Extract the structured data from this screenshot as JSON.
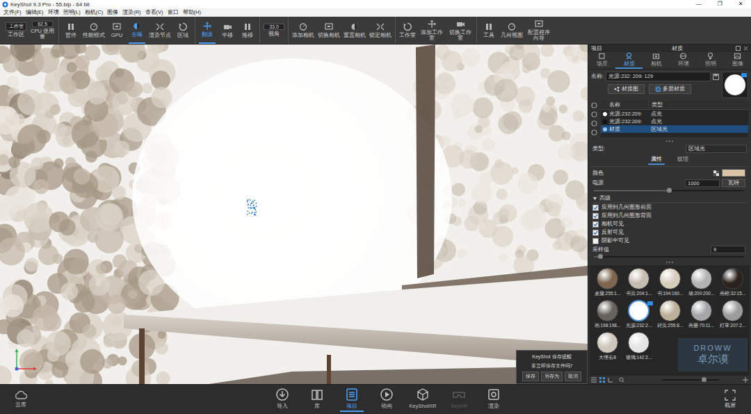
{
  "window": {
    "title": "KeyShot 9.3 Pro  - 55.bip  - 64 bit",
    "controls": [
      "—",
      "❐",
      "✕"
    ]
  },
  "menu": [
    "文件(F)",
    "编辑(E)",
    "环境",
    "照明(L)",
    "相机(C)",
    "图像",
    "渲染(R)",
    "查看(V)",
    "窗口",
    "帮助(H)"
  ],
  "toolbar": [
    [
      {
        "label": "工作区",
        "kind": "field",
        "value": "工作室",
        "active": false
      },
      {
        "label": "CPU 使用量",
        "kind": "field",
        "value": "62.5",
        "active": false
      }
    ],
    [
      {
        "label": "暂停",
        "kind": "button",
        "active": false
      },
      {
        "label": "性能模式",
        "kind": "button",
        "active": false
      },
      {
        "label": "GPU",
        "kind": "button",
        "active": false
      },
      {
        "label": "去噪",
        "kind": "button",
        "active": true
      },
      {
        "label": "渲染节点",
        "kind": "button",
        "active": false
      },
      {
        "label": "区域",
        "kind": "button",
        "active": false
      }
    ],
    [
      {
        "label": "翻滚",
        "kind": "button",
        "active": true
      },
      {
        "label": "平移",
        "kind": "button",
        "active": false
      },
      {
        "label": "推移",
        "kind": "button",
        "active": false
      }
    ],
    [
      {
        "label": "视角",
        "kind": "field",
        "value": "33.0",
        "active": false
      }
    ],
    [
      {
        "label": "添加相机",
        "kind": "button",
        "active": false
      },
      {
        "label": "切换相机",
        "kind": "button",
        "active": false
      },
      {
        "label": "重置相机",
        "kind": "button",
        "active": false
      },
      {
        "label": "锁定相机",
        "kind": "button",
        "active": false
      }
    ],
    [
      {
        "label": "工作室",
        "kind": "button",
        "active": false
      },
      {
        "label": "添加工作室",
        "kind": "button",
        "active": false
      },
      {
        "label": "切换工作室",
        "kind": "button",
        "active": false
      }
    ],
    [
      {
        "label": "工具",
        "kind": "button",
        "active": false
      },
      {
        "label": "几何视图",
        "kind": "button",
        "active": false
      },
      {
        "label": "配置程序向导",
        "kind": "button",
        "active": false
      }
    ]
  ],
  "dialog": {
    "title": "KeyShot 保存提醒",
    "message": "要立即保存文件吗?",
    "buttons": [
      "保存",
      "另存为",
      "取消"
    ]
  },
  "panel": {
    "title": "项目",
    "subtitle": "材质",
    "tabs": [
      {
        "label": "场景",
        "selected": false
      },
      {
        "label": "材质",
        "selected": true
      },
      {
        "label": "相机",
        "selected": false
      },
      {
        "label": "环境",
        "selected": false
      },
      {
        "label": "照明",
        "selected": false
      },
      {
        "label": "图像",
        "selected": false
      }
    ],
    "name_label": "名称:",
    "name_value": "光源:232: 209: 129",
    "buttons": [
      "材质图",
      "多层材质"
    ],
    "list": {
      "columns": [
        "名称",
        "类型"
      ],
      "rows": [
        {
          "name": "光源:232:209:",
          "type": "点光",
          "color": "#ffffff",
          "selected": false
        },
        {
          "name": "光源:232:209:",
          "type": "点光",
          "color": "#111111",
          "selected": false
        },
        {
          "name": "材质",
          "type": "区域光",
          "color": "#9cc8f0",
          "selected": true
        }
      ]
    },
    "type_label": "类型:",
    "type_value": "区域光",
    "subtabs": [
      {
        "label": "属性",
        "selected": true
      },
      {
        "label": "纹理",
        "selected": false
      }
    ],
    "color_label": "颜色",
    "color_value": "#d9c3a6",
    "power": {
      "label": "电源",
      "value": "1000",
      "unit": "瓦特",
      "level": 0.5
    },
    "advanced": {
      "title": "高级",
      "expanded": true,
      "options": [
        {
          "label": "应用到几何图形前面",
          "checked": true
        },
        {
          "label": "应用到几何图形背面",
          "checked": true
        },
        {
          "label": "相机可见",
          "checked": true
        },
        {
          "label": "反射可见",
          "checked": true
        },
        {
          "label": "阴影中可见",
          "checked": false
        }
      ]
    },
    "samples": {
      "label": "采样值",
      "value": "9",
      "level": 0.04
    },
    "materials": [
      {
        "label": "桌腿:255:1...",
        "color": "#7d6550",
        "selected": false
      },
      {
        "label": "书页:204:1...",
        "color": "#c6bdb1",
        "selected": false
      },
      {
        "label": "书:194:160...",
        "color": "#d6ccbc",
        "selected": false
      },
      {
        "label": "墙:200:200...",
        "color": "#b3b3b3",
        "selected": false
      },
      {
        "label": "画框:32:15...",
        "color": "#2a221c",
        "selected": false
      },
      {
        "label": "画:198:198...",
        "color": "#67625d",
        "selected": false
      },
      {
        "label": "光源:232:2...",
        "color": "#ffffff",
        "selected": true
      },
      {
        "label": "封页:255:8...",
        "color": "#bdb09a",
        "selected": false
      },
      {
        "label": "画册:70:11...",
        "color": "#a4a6a8",
        "selected": false
      },
      {
        "label": "灯罩:207:2...",
        "color": "#9c9c9c",
        "selected": false
      },
      {
        "label": "大理石8",
        "color": "#cdc6bb",
        "selected": false
      },
      {
        "label": "玻璃:142:2...",
        "color": "#e4e4e4",
        "selected": false
      }
    ]
  },
  "bottom": {
    "left": "云库",
    "tabs": [
      {
        "label": "导入",
        "selected": false,
        "disabled": false
      },
      {
        "label": "库",
        "selected": false,
        "disabled": false
      },
      {
        "label": "项目",
        "selected": true,
        "disabled": false
      },
      {
        "label": "动画",
        "selected": false,
        "disabled": false
      },
      {
        "label": "KeyShotXR",
        "selected": false,
        "disabled": false
      },
      {
        "label": "KeyVR",
        "selected": false,
        "disabled": true
      },
      {
        "label": "渲染",
        "selected": false,
        "disabled": false
      }
    ],
    "right": "截屏"
  },
  "watermark": {
    "line1": "DROWW",
    "line2": "卓尔谟"
  }
}
